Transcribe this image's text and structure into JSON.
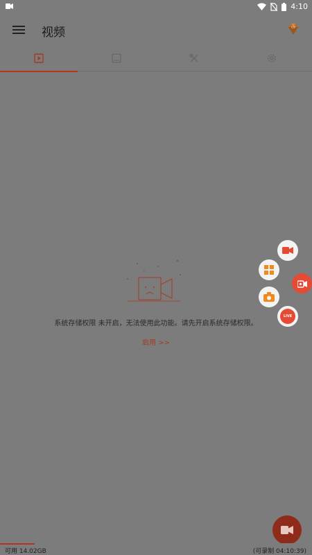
{
  "status_bar": {
    "time": "4:10"
  },
  "header": {
    "title": "视频"
  },
  "tabs": [
    {
      "id": "videos",
      "icon": "video-play-icon",
      "active": true
    },
    {
      "id": "images",
      "icon": "image-icon",
      "active": false
    },
    {
      "id": "tools",
      "icon": "tools-icon",
      "active": false
    },
    {
      "id": "settings",
      "icon": "gear-icon",
      "active": false
    }
  ],
  "empty_state": {
    "message": "系统存储权限 未开启，无法使用此功能。请先开启系统存储权限。",
    "enable_link": "启用 >>"
  },
  "floating_menu": {
    "live_label": "LIVE",
    "items": [
      "record-video-icon",
      "apps-grid-icon",
      "screenshot-camera-icon",
      "live-icon",
      "floating-record-icon"
    ]
  },
  "footer": {
    "available": "可用 14.02GB",
    "recordable": "(可录制 04:10:39)",
    "storage_used_fraction": 0.11
  },
  "colors": {
    "accent": "#b4341f",
    "fab_red": "#e64a32",
    "bg_dim": "#7c7c7c"
  }
}
